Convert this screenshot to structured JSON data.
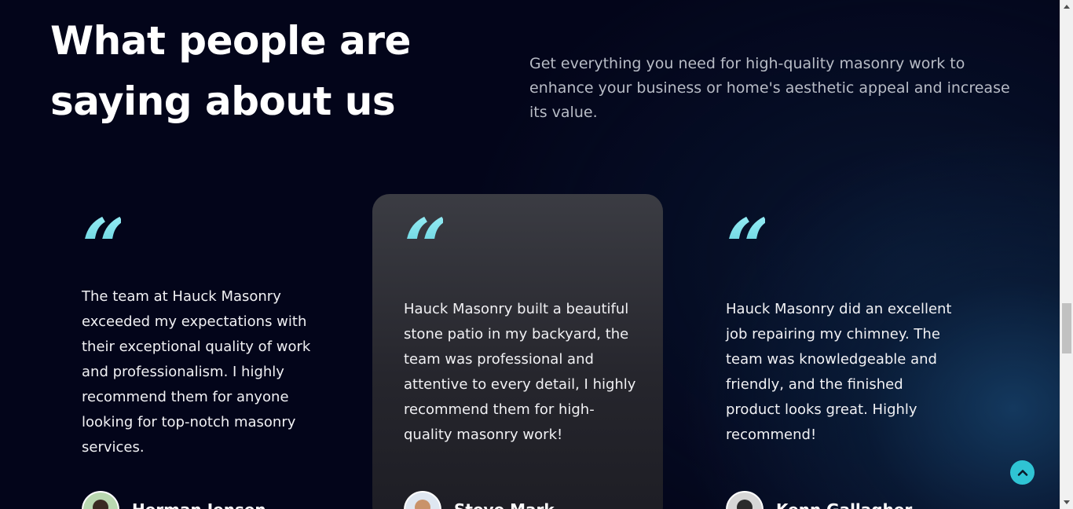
{
  "section": {
    "title_line1": "What people are",
    "title_line2": "saying about us",
    "intro": "Get everything you need for high-quality masonry work to enhance your business or home's aesthetic appeal and increase its value."
  },
  "testimonials": [
    {
      "quote_mark": "“",
      "text": "The team at Hauck Masonry exceeded my expectations with their exceptional quality of work and professionalism. I highly recommend them for anyone looking for top-notch masonry services.",
      "author": "Herman Jensen",
      "highlighted": false
    },
    {
      "quote_mark": "“",
      "text": "Hauck Masonry built a beautiful stone patio in my backyard, the team was professional and attentive to every detail, I highly recommend them for high-quality masonry work!",
      "author": "Steve Mark",
      "highlighted": true
    },
    {
      "quote_mark": "“",
      "text": "Hauck Masonry did an excellent job repairing my chimney. The team was knowledgeable and friendly, and the finished product looks great. Highly recommend!",
      "author": "Kenn Gallagher",
      "highlighted": false
    }
  ],
  "colors": {
    "background": "#03051a",
    "accent": "#2fc4d4",
    "highlight_card": "#2f3037"
  },
  "icons": {
    "quote": "quote-icon",
    "scroll_top": "chevron-up-icon"
  }
}
